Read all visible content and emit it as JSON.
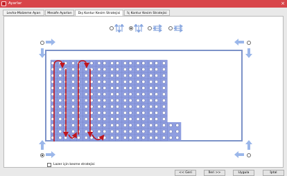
{
  "window": {
    "title": "Ayarlar",
    "close_symbol": "×"
  },
  "tabs": [
    {
      "label": "Levha-Malzeme Ayarı",
      "active": false
    },
    {
      "label": "Mesafe Ayarları",
      "active": false
    },
    {
      "label": "Dış Kontur Kesim Stratejisi",
      "active": true
    },
    {
      "label": "İç Kontur Kesim Stratejisi",
      "active": false
    }
  ],
  "strategy_options": [
    {
      "icon": "vertical-arrows-up-down-icon",
      "selected": false
    },
    {
      "icon": "vertical-arrows-alternating-icon",
      "selected": true
    },
    {
      "icon": "horizontal-arrows-right-left-icon",
      "selected": false
    },
    {
      "icon": "horizontal-arrows-alternating-icon",
      "selected": false
    }
  ],
  "corner_options": [
    {
      "corner": "top-left",
      "selected": false
    },
    {
      "corner": "top-right",
      "selected": false
    },
    {
      "corner": "bottom-left",
      "selected": true
    },
    {
      "corner": "bottom-right",
      "selected": false
    }
  ],
  "colors": {
    "accent": "#d8454a",
    "arrow_blue": "#8aa8e0",
    "part_fill": "#8f9ee0",
    "path_red": "#c0141c",
    "frame_blue": "#7c92c8"
  },
  "laser_option": {
    "label": "Lazer için kesme stratejisi",
    "checked": false
  },
  "buttons": {
    "back": "<< Geri",
    "next": "İleri >>",
    "apply": "Uygula",
    "cancel": "İptal"
  }
}
